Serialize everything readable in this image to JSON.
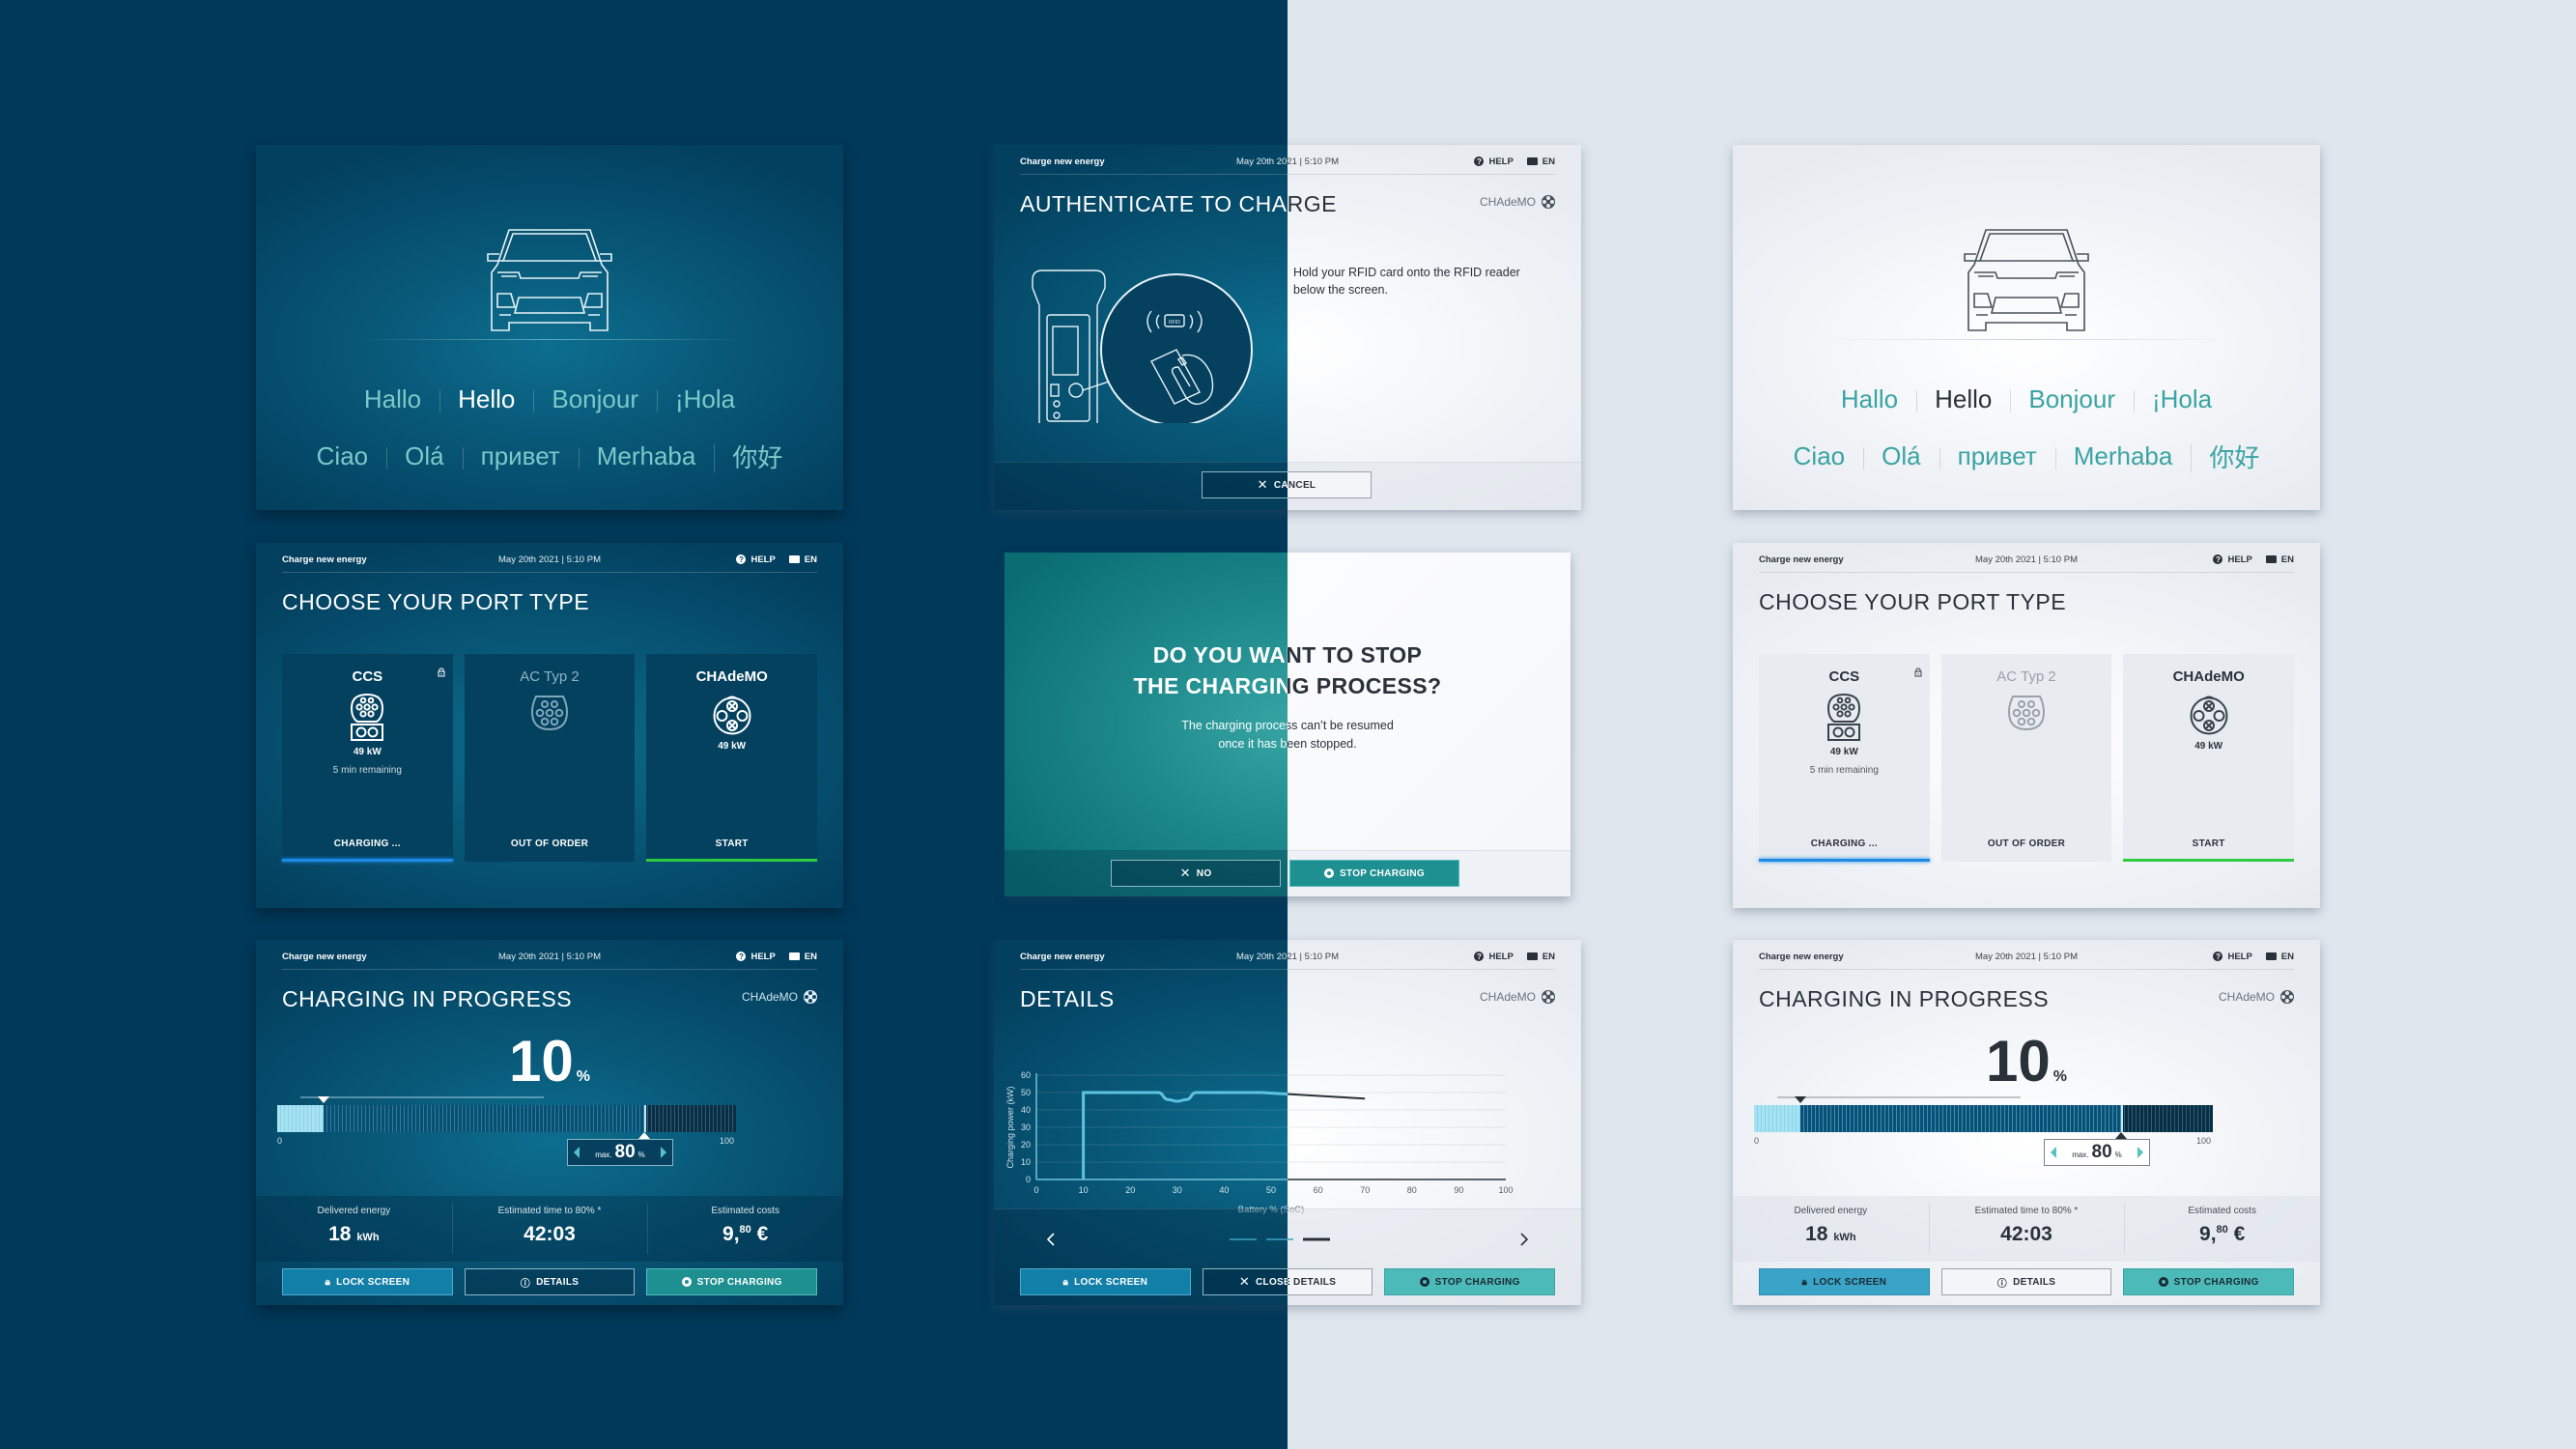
{
  "theme_colors": {
    "dark_background": "#00395a",
    "light_background": "#e0e6ee",
    "accent_teal": "#3aa3a3",
    "charging_blue": "#1c8be6",
    "start_green": "#2ecc40"
  },
  "header": {
    "brand": "Charge new energy",
    "datetime": "May 20th 2021 | 5:10 PM",
    "help_label": "HELP",
    "lang_label": "EN",
    "help_icon": "question-circle-icon",
    "lang_icon": "speech-bubble-icon"
  },
  "welcome": {
    "row1": [
      "Hallo",
      "Hello",
      "Bonjour",
      "¡Hola"
    ],
    "row2": [
      "Ciao",
      "Olá",
      "привет",
      "Merhaba",
      "你好"
    ],
    "active": "Hello"
  },
  "authenticate": {
    "title": "AUTHENTICATE TO CHARGE",
    "plug": "CHAdeMO",
    "instruction": "Hold your RFID card onto the RFID reader below the screen.",
    "rfid_label": "RFID",
    "cancel_label": "CANCEL"
  },
  "port_select": {
    "title": "CHOOSE YOUR PORT TYPE",
    "ports": [
      {
        "name": "CCS",
        "power": "49 kW",
        "remaining": "5 min remaining",
        "status": "CHARGING ...",
        "locked": true,
        "state": "charging"
      },
      {
        "name": "AC Typ 2",
        "power": "",
        "remaining": "",
        "status": "OUT OF ORDER",
        "locked": false,
        "state": "disabled"
      },
      {
        "name": "CHAdeMO",
        "power": "49 kW",
        "remaining": "",
        "status": "START",
        "locked": false,
        "state": "available"
      }
    ]
  },
  "stop_dialog": {
    "title_line1": "DO YOU WANT TO STOP",
    "title_line2": "THE CHARGING PROCESS?",
    "sub_line1": "The charging process can’t be resumed",
    "sub_line2": "once it has been stopped.",
    "no_label": "NO",
    "stop_label": "STOP CHARGING"
  },
  "charging": {
    "title": "CHARGING IN PROGRESS",
    "plug": "CHAdeMO",
    "soc_percent": 10,
    "soc_value": "10",
    "percent_sign": "%",
    "max_percent": 80,
    "max_label": "max.",
    "max_value": "80",
    "scale_min": "0",
    "scale_max": "100",
    "stats": [
      {
        "label": "Delivered energy",
        "value": "18",
        "unit": "kWh"
      },
      {
        "label": "Estimated time to 80% *",
        "value": "42:03",
        "unit": ""
      },
      {
        "label": "Estimated costs",
        "value": "9,",
        "sup": "80",
        "unit": "€"
      }
    ],
    "buttons": {
      "lock": "LOCK SCREEN",
      "details": "DETAILS",
      "stop": "STOP CHARGING"
    }
  },
  "details": {
    "title": "DETAILS",
    "plug": "CHAdeMO",
    "buttons": {
      "lock": "LOCK SCREEN",
      "close": "CLOSE DETAILS",
      "stop": "STOP CHARGING"
    },
    "pager": {
      "pages": 3,
      "active": 3
    }
  },
  "chart_data": {
    "type": "line",
    "title": "",
    "xlabel": "Battery % (SoC)",
    "ylabel": "Charging power (kW)",
    "xlim": [
      0,
      100
    ],
    "ylim": [
      0,
      60
    ],
    "xticks": [
      0,
      10,
      20,
      30,
      40,
      50,
      60,
      70,
      80,
      90,
      100
    ],
    "yticks": [
      0,
      10,
      20,
      30,
      40,
      50,
      60
    ],
    "grid": true,
    "series": [
      {
        "name": "Charging power",
        "x": [
          10,
          10,
          26,
          28,
          30,
          32,
          34,
          48,
          70
        ],
        "y": [
          0,
          50,
          50,
          46,
          45,
          46,
          50,
          50,
          46.5
        ]
      }
    ]
  }
}
